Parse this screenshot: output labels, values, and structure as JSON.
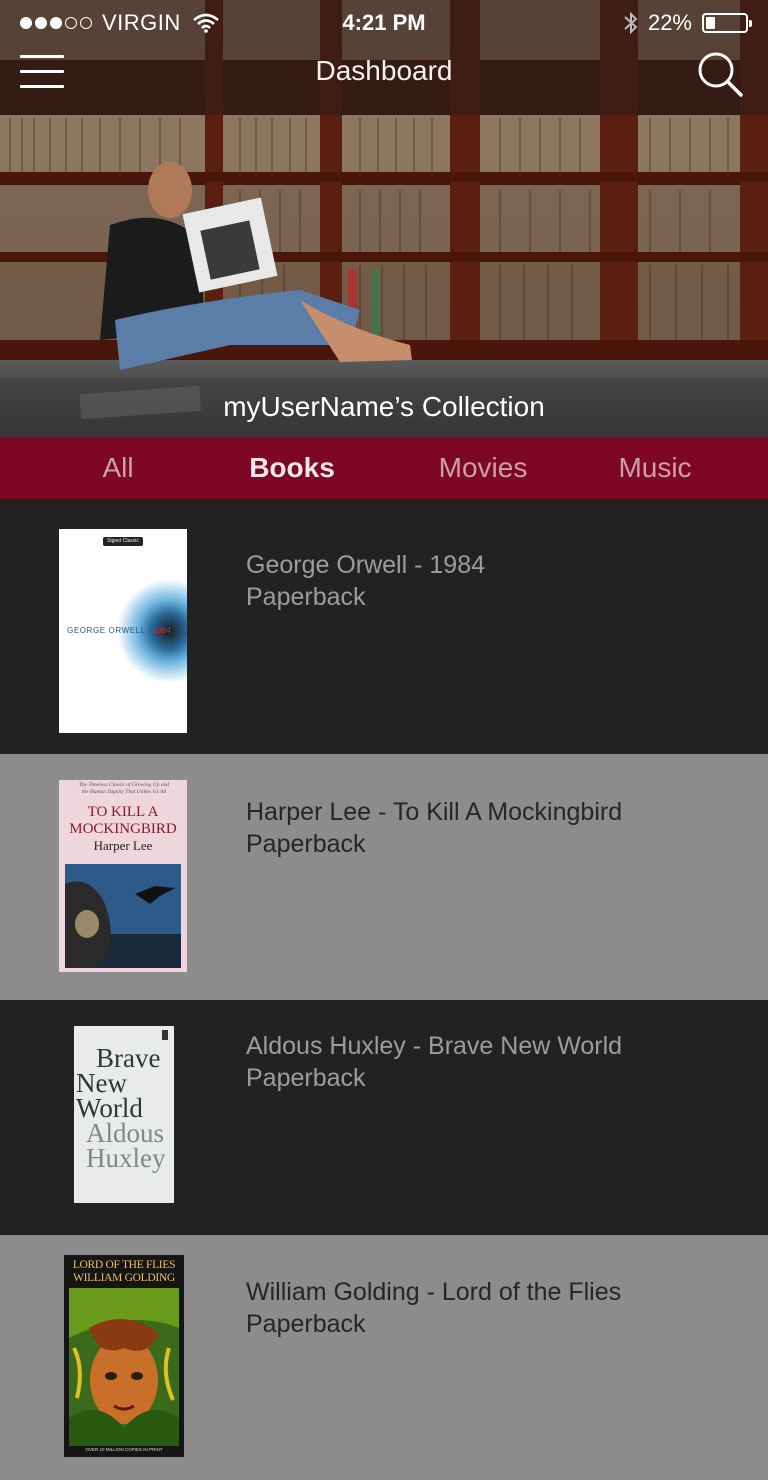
{
  "status_bar": {
    "carrier": "VIRGIN",
    "time": "4:21 PM",
    "battery": "22%",
    "signal_bars_filled": 3,
    "signal_bars_total": 5,
    "battery_level": 0.22
  },
  "header": {
    "title": "Dashboard",
    "menu_icon": "hamburger-menu-icon",
    "search_icon": "search-icon"
  },
  "hero": {
    "caption": "myUserName’s Collection"
  },
  "tabs": [
    {
      "label": "All",
      "active": false
    },
    {
      "label": "Books",
      "active": true
    },
    {
      "label": "Movies",
      "active": false
    },
    {
      "label": "Music",
      "active": false
    }
  ],
  "colors": {
    "tab_bar": "#7d0724",
    "row_dark": "#222222",
    "row_light": "#8c8c8c"
  },
  "items": [
    {
      "title": "George Orwell - 1984",
      "format": "Paperback",
      "cover": {
        "author": "GEORGE ORWELL",
        "number": "1984",
        "publisher": "Signet Classic"
      }
    },
    {
      "title": "Harper Lee - To Kill A Mockingbird",
      "format": "Paperback",
      "cover": {
        "tagline_1": "The Timeless Classic of Growing Up and",
        "tagline_2": "the Human Dignity That Unites Us All",
        "line_1": "TO KILL A",
        "line_2": "MOCKINGBIRD",
        "author": "Harper Lee"
      }
    },
    {
      "title": "Aldous Huxley - Brave New World",
      "format": "Paperback",
      "cover": {
        "line_1": "Brave",
        "line_2": "New",
        "line_3": "World",
        "line_4": "Aldous",
        "line_5": "Huxley"
      }
    },
    {
      "title": "William Golding - Lord of the Flies",
      "format": "Paperback",
      "cover": {
        "line_1": "LORD OF THE FLIES",
        "line_2": "WILLIAM GOLDING",
        "footer": "OVER 10 MILLION COPIES IN PRINT"
      }
    }
  ]
}
